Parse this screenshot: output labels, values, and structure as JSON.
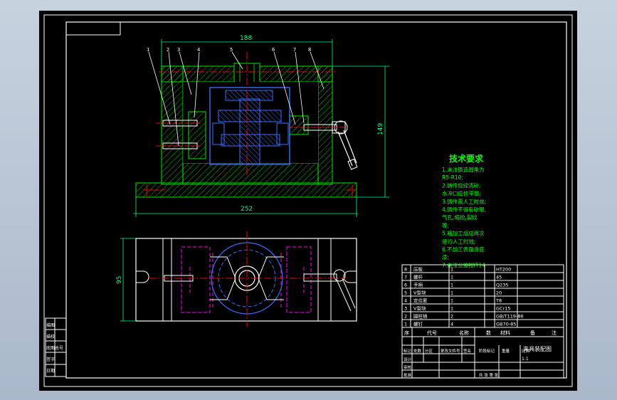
{
  "colors": {
    "background": "#000000",
    "frame": "#ffffff",
    "section": "#00c000",
    "hidden": "#ff00ff",
    "blue": "#0000ff",
    "red": "#ff0000",
    "dimension": "#00ff80",
    "text": "#00ff00"
  },
  "dimensions": {
    "top_width": "188",
    "height": "149",
    "base_width": "252",
    "plan_depth": "95"
  },
  "part_callouts": [
    "1",
    "2",
    "3",
    "4",
    "5",
    "6",
    "7",
    "8"
  ],
  "tech_requirements": {
    "title": "技术要求",
    "lines": [
      "1.未注铸造圆角为",
      "R5-R10;",
      "2.铸件应经清砂,",
      "水冲口应修平整;",
      "3.铸件需人工时效;",
      "4.铸件不得有砂眼,",
      "气孔,缩松,裂纹",
      "等;",
      "5.粗加工后应再次",
      "进行人工时效;",
      "6.不加工表面涂底",
      "漆;",
      "7.未注公差按IT14"
    ]
  },
  "bom": {
    "rows": [
      {
        "no": "8",
        "name": "压板",
        "qty": "1",
        "material": "HT200"
      },
      {
        "no": "7",
        "name": "螺杆",
        "qty": "1",
        "material": "45"
      },
      {
        "no": "6",
        "name": "手柄",
        "qty": "1",
        "material": "Q235"
      },
      {
        "no": "5",
        "name": "V型块",
        "qty": "1",
        "material": "20"
      },
      {
        "no": "4",
        "name": "定位套",
        "qty": "1",
        "material": "T8"
      },
      {
        "no": "3",
        "name": "V型块",
        "qty": "1",
        "material": "GCr15"
      },
      {
        "no": "2",
        "name": "圆柱销",
        "qty": "2",
        "material": "GB/T119-86"
      },
      {
        "no": "1",
        "name": "螺钉",
        "qty": "4",
        "material": "GB70-85"
      }
    ],
    "header": [
      "序",
      "代号",
      "名称",
      "数",
      "材料",
      "备",
      "注"
    ]
  },
  "title_block": {
    "drawing_title": "夹具装配图",
    "row_labels": [
      "标记",
      "处数",
      "分区",
      "更改文件号",
      "签名",
      "年月日"
    ],
    "design": "设计",
    "check": "审核",
    "approve": "批准",
    "stage": "阶段标记",
    "weight": "重量",
    "scale": "比例",
    "scale_value": "1:1",
    "sheet": "共 张 第 张"
  },
  "left_strip": [
    "描图",
    "描校",
    "底图总号",
    "签字",
    "日期"
  ]
}
